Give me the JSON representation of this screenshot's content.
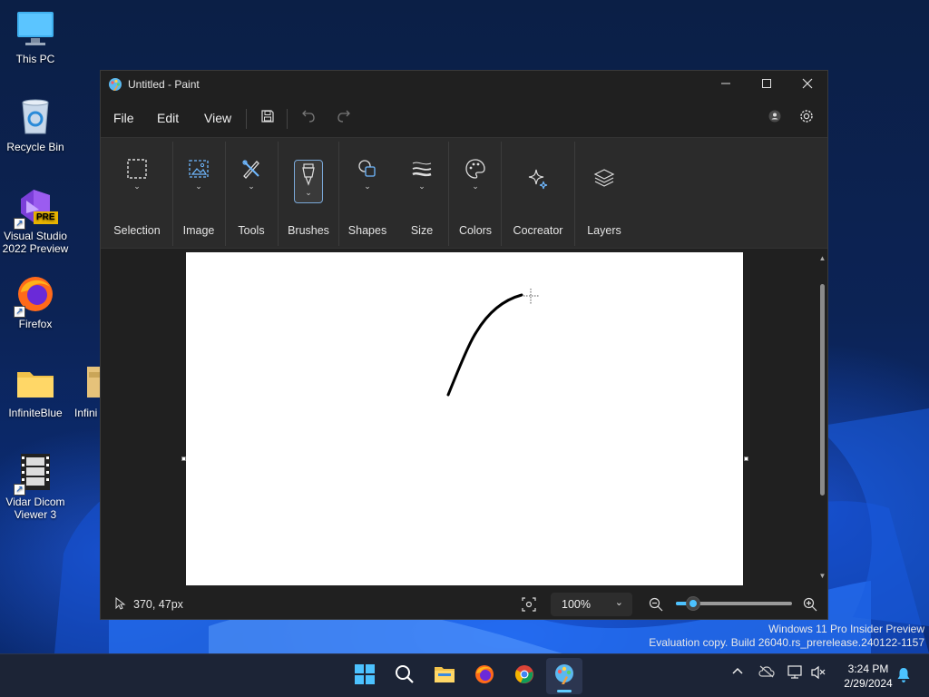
{
  "desktop": {
    "icons": [
      {
        "label": "This PC",
        "icon": "monitor-icon"
      },
      {
        "label": "Recycle Bin",
        "icon": "recycle-bin-icon"
      },
      {
        "label": "Visual Studio 2022 Preview",
        "icon": "visual-studio-icon",
        "badge": "PRE"
      },
      {
        "label": "Firefox",
        "icon": "firefox-icon"
      },
      {
        "label": "InfiniteBlue",
        "icon": "folder-icon"
      },
      {
        "label": "Infini",
        "icon": "installer-icon"
      },
      {
        "label": "Vidar Dicom Viewer 3",
        "icon": "film-icon"
      }
    ]
  },
  "window": {
    "title": "Untitled - Paint",
    "controls": {
      "minimize": "minimize-icon",
      "maximize": "maximize-icon",
      "close": "close-icon"
    }
  },
  "menu": {
    "file": "File",
    "edit": "Edit",
    "view": "View"
  },
  "ribbon": {
    "groups": [
      {
        "label": "Selection",
        "icon": "selection-rectangle-icon"
      },
      {
        "label": "Image",
        "icon": "image-icon"
      },
      {
        "label": "Tools",
        "icon": "tools-icon"
      },
      {
        "label": "Brushes",
        "icon": "brush-icon"
      },
      {
        "label": "Shapes",
        "icon": "shapes-icon"
      },
      {
        "label": "Size",
        "icon": "size-icon"
      },
      {
        "label": "Colors",
        "icon": "palette-icon"
      },
      {
        "label": "Cocreator",
        "icon": "sparkle-icon"
      },
      {
        "label": "Layers",
        "icon": "layers-icon"
      }
    ],
    "active_group": "Brushes"
  },
  "status": {
    "cursor_position": "370, 47px",
    "zoom": "100%",
    "zoom_level": 0.15
  },
  "watermark": {
    "line1": "Windows 11 Pro Insider Preview",
    "line2": "Evaluation copy. Build 26040.rs_prerelease.240122-1157"
  },
  "taskbar": {
    "apps": [
      "start-icon",
      "search-icon",
      "file-explorer-icon",
      "firefox-icon",
      "chrome-icon",
      "paint-icon"
    ],
    "clock": {
      "time": "3:24 PM",
      "date": "2/29/2024"
    }
  },
  "colors": {
    "accent": "#4cc2ff",
    "window_bg": "#202020",
    "ribbon_bg": "#2b2b2b"
  }
}
